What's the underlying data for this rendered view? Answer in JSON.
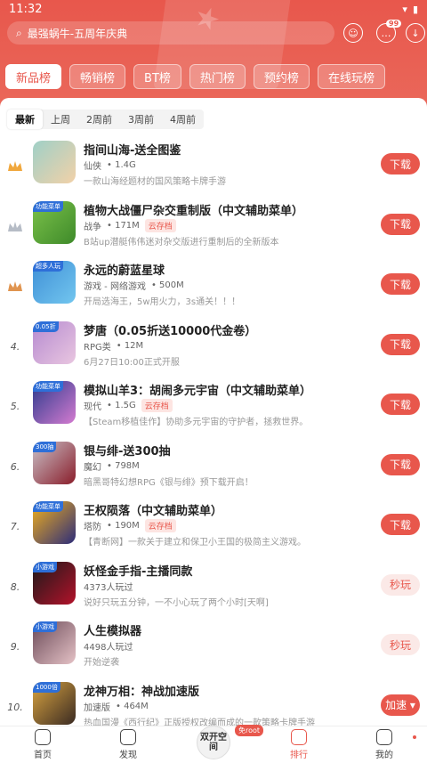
{
  "status": {
    "time": "11:32",
    "battery_icon": "battery-icon",
    "wifi_icon": "wifi-icon"
  },
  "search": {
    "placeholder": "最强蜗牛-五周年庆典"
  },
  "top_icons": {
    "notification_badge": "99"
  },
  "tabs": [
    {
      "label": "新品榜",
      "active": true
    },
    {
      "label": "畅销榜"
    },
    {
      "label": "BT榜"
    },
    {
      "label": "热门榜"
    },
    {
      "label": "预约榜"
    },
    {
      "label": "在线玩榜"
    }
  ],
  "subtabs": [
    {
      "label": "最新",
      "active": true
    },
    {
      "label": "上周"
    },
    {
      "label": "2周前"
    },
    {
      "label": "3周前"
    },
    {
      "label": "4周前"
    }
  ],
  "games": [
    {
      "rank": "",
      "crown": "gold",
      "title": "指间山海-送全图鉴",
      "genre": "仙侠",
      "size": "1.4G",
      "desc": "一款山海经题材的国风策略卡牌手游",
      "action": "下载",
      "tag": "",
      "icon_colors": [
        "#9fd0c7",
        "#f2d1a8"
      ]
    },
    {
      "rank": "",
      "crown": "silver",
      "title": "植物大战僵尸杂交重制版（中文辅助菜单）",
      "genre": "战争",
      "size": "171M",
      "cloud": "云存档",
      "desc": "B站up潜艇伟伟迷对杂交版进行重制后的全新版本",
      "action": "下载",
      "tag": "功能菜单",
      "icon_colors": [
        "#7cc24a",
        "#3e8a2a"
      ]
    },
    {
      "rank": "",
      "crown": "bronze",
      "title": "永远的蔚蓝星球",
      "genre": "游戏 - 网络游戏",
      "size": "500M",
      "desc": "开局选海王，5w用火力，3s通关！！！",
      "action": "下载",
      "tag": "超多人玩",
      "icon_colors": [
        "#3f8fd6",
        "#72c6ef"
      ]
    },
    {
      "rank": "4.",
      "crown": "",
      "title": "梦唐（0.05折送10000代金卷）",
      "genre": "RPG类",
      "size": "12M",
      "desc": "6月27日10:00正式开服",
      "action": "下载",
      "tag": "0.05折",
      "icon_colors": [
        "#b58ad0",
        "#e9c6e0"
      ]
    },
    {
      "rank": "5.",
      "crown": "",
      "title": "模拟山羊3：胡闹多元宇宙（中文辅助菜单）",
      "genre": "现代",
      "size": "1.5G",
      "cloud": "云存档",
      "desc": "【Steam移植佳作】协助多元宇宙的守护者，拯救世界。",
      "action": "下载",
      "tag": "功能菜单",
      "icon_colors": [
        "#2b3a8c",
        "#d47bd0"
      ]
    },
    {
      "rank": "6.",
      "crown": "",
      "title": "银与绯-送300抽",
      "genre": "魔幻",
      "size": "798M",
      "desc": "暗黑哥特幻想RPG《银与绯》预下载开启！",
      "action": "下载",
      "tag": "300抽",
      "icon_colors": [
        "#c9c2c9",
        "#8a1d2a"
      ]
    },
    {
      "rank": "7.",
      "crown": "",
      "title": "王权陨落（中文辅助菜单）",
      "genre": "塔防",
      "size": "190M",
      "cloud": "云存档",
      "desc": "【青断网】一款关于建立和保卫小王国的极简主义游戏。",
      "action": "下载",
      "tag": "功能菜单",
      "icon_colors": [
        "#f4b21c",
        "#2c2c7a"
      ]
    },
    {
      "rank": "8.",
      "crown": "",
      "title": "妖怪金手指-主播同款",
      "genre": "4373人玩过",
      "size": "",
      "desc": "说好只玩五分钟，一不小心玩了两个小时[天啊]",
      "action": "秒玩",
      "secondary": true,
      "tag": "小游戏",
      "icon_colors": [
        "#1a1a1a",
        "#b3122a"
      ]
    },
    {
      "rank": "9.",
      "crown": "",
      "title": "人生模拟器",
      "genre": "4498人玩过",
      "size": "",
      "desc": "开始逆袭",
      "action": "秒玩",
      "secondary": true,
      "tag": "小游戏",
      "icon_colors": [
        "#6b4a58",
        "#e5c2c6"
      ]
    },
    {
      "rank": "10.",
      "crown": "",
      "title": "龙神万相：神战加速版",
      "genre": "加速版",
      "size": "464M",
      "desc": "热血国漫《西行纪》正版授权改编而成的一款策略卡牌手游",
      "action": "加速 ▾",
      "tag": "1000倍",
      "icon_colors": [
        "#d9a441",
        "#3a2a22"
      ]
    }
  ],
  "bottom_nav": [
    {
      "label": "首页",
      "icon": "home-icon"
    },
    {
      "label": "发现",
      "icon": "discover-icon"
    },
    {
      "label": "双开空间",
      "icon": "dual-space-icon"
    },
    {
      "label": "排行",
      "icon": "ranking-icon",
      "active": true
    },
    {
      "label": "我的",
      "icon": "profile-icon"
    }
  ],
  "root_badge": "免root",
  "colors": {
    "accent": "#e8574c",
    "gold": "#f0a73c",
    "silver": "#b6bcc6",
    "bronze": "#e0944f"
  }
}
